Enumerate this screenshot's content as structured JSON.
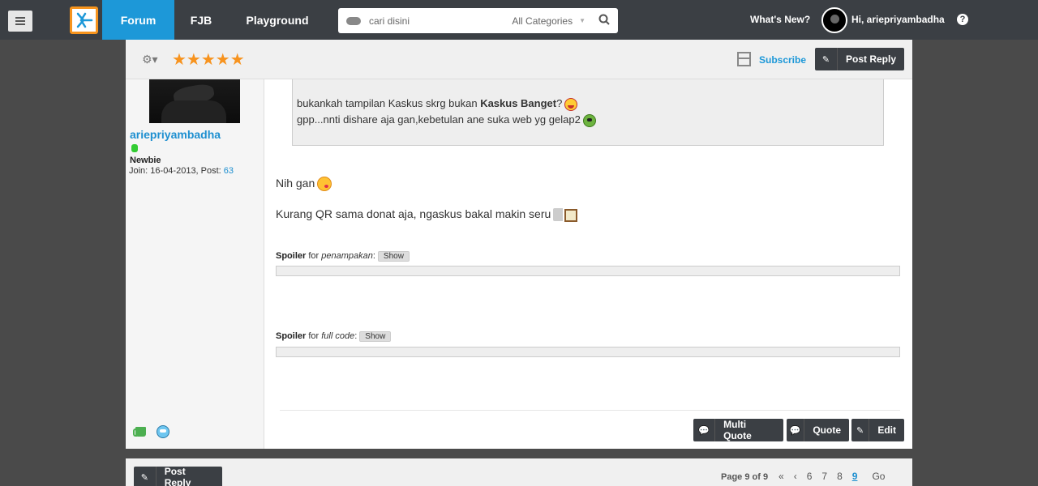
{
  "nav": {
    "tabs": [
      "Forum",
      "FJB",
      "Playground"
    ],
    "search_placeholder": "cari disini",
    "search_category": "All Categories",
    "whats_new": "What's New?",
    "greeting": "Hi, ariepriyambadha",
    "help": "?"
  },
  "post_header": {
    "rating_stars": "★★★★★",
    "rating": 5,
    "subscribe": "Subscribe",
    "post_reply": "Post Reply"
  },
  "user": {
    "username": "ariepriyambadha",
    "rank": "Newbie",
    "join_label": "Join: 16-04-2013, Post: ",
    "post_count": "63"
  },
  "quote": {
    "line1_pre": "bukankah tampilan Kaskus skrg bukan ",
    "line1_bold": "Kaskus Banget",
    "line1_post": "?",
    "line2": "gpp...nnti dishare aja gan,kebetulan ane suka web yg gelap2"
  },
  "message": {
    "line1": "Nih gan",
    "line2": "Kurang QR sama donat aja, ngaskus bakal makin seru"
  },
  "spoilers": [
    {
      "bold": "Spoiler",
      "for": " for ",
      "title": "penampakan",
      "colon": ":",
      "button": "Show"
    },
    {
      "bold": "Spoiler",
      "for": " for ",
      "title": "full code",
      "colon": ":",
      "button": "Show"
    }
  ],
  "post_actions": {
    "multi_quote": "Multi Quote",
    "quote": "Quote",
    "edit": "Edit"
  },
  "footer": {
    "post_reply": "Post Reply",
    "page_info": "Page 9 of 9",
    "pages": [
      "6",
      "7",
      "8",
      "9"
    ],
    "current_page": "9",
    "go": "Go"
  },
  "colors": {
    "nav_bg": "#3b3f44",
    "forum_tab": "#1d98d8",
    "star": "#f7931e",
    "link": "#1d8fd0"
  }
}
